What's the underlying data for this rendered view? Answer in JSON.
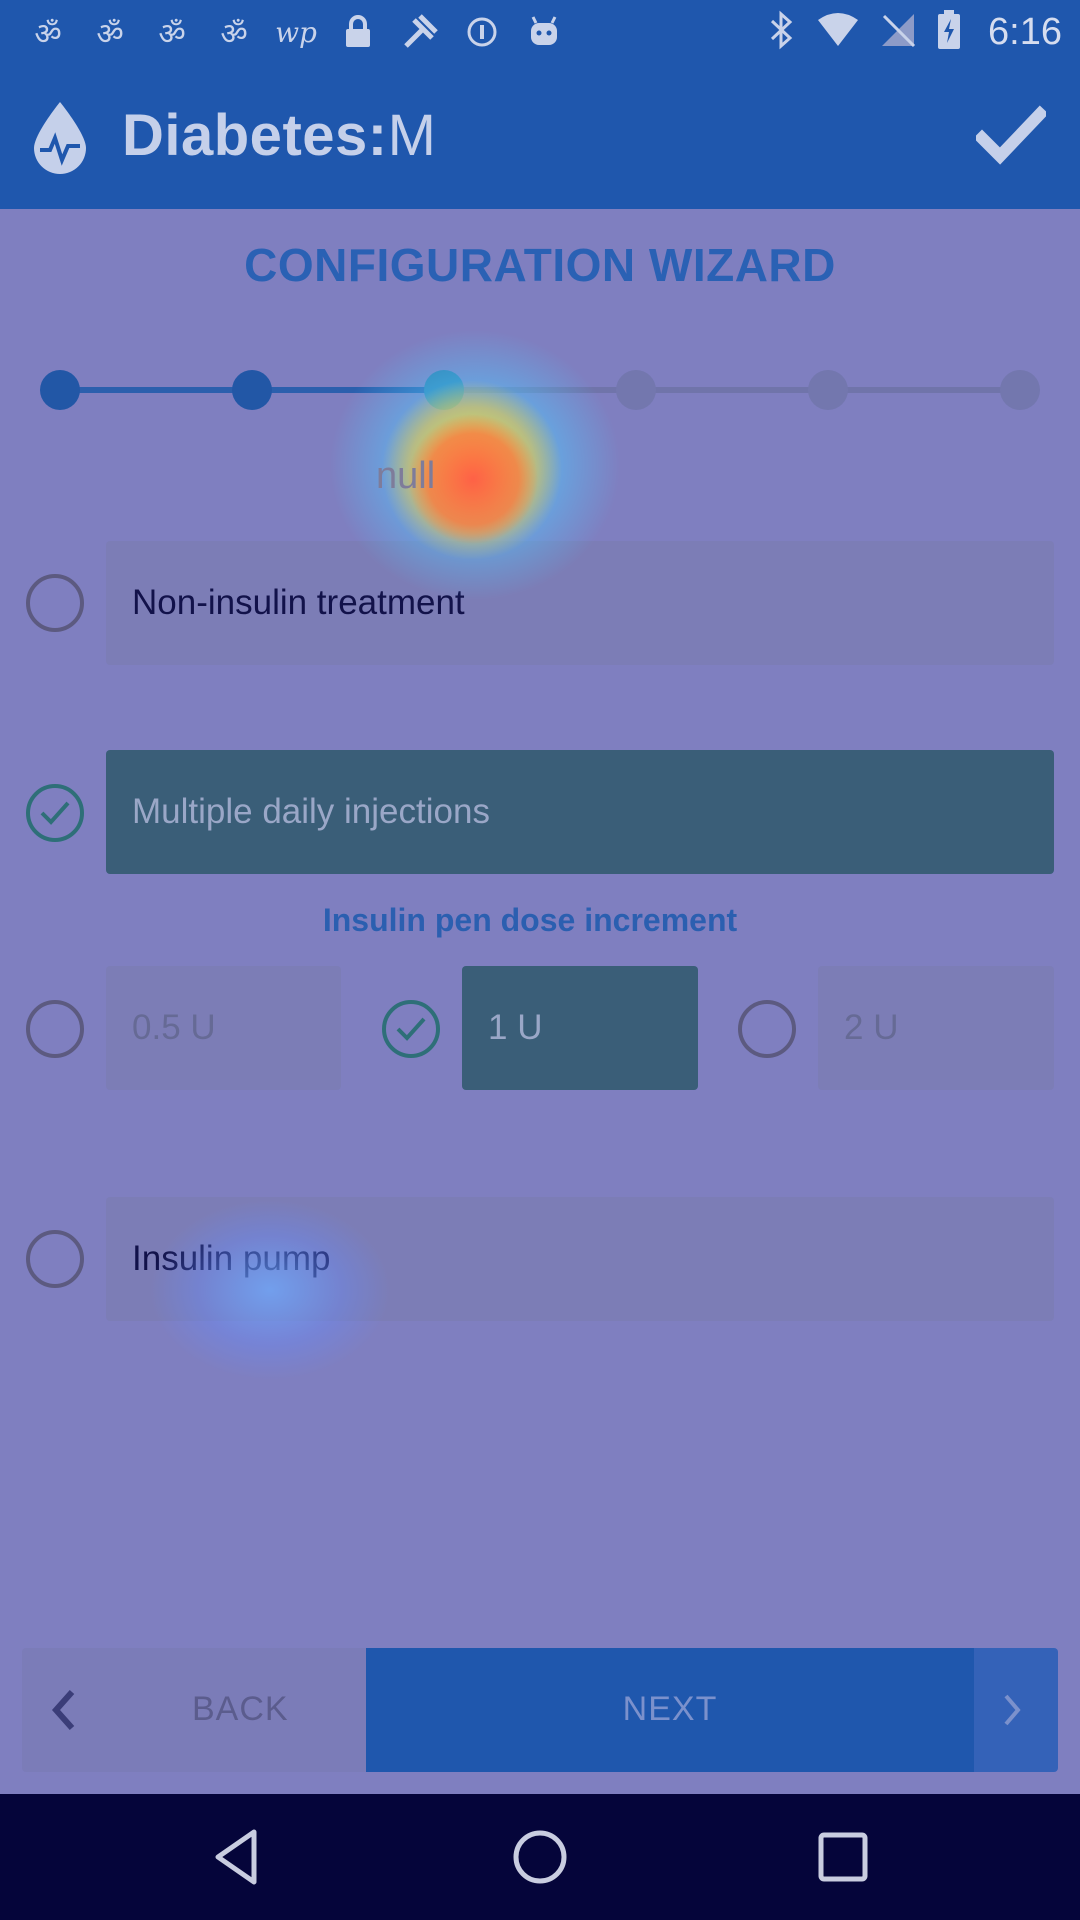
{
  "status_bar": {
    "time": "6:16",
    "left_icons": [
      "notification-icon",
      "notification-icon",
      "notification-icon",
      "notification-icon",
      "wp-icon",
      "lock-icon",
      "satellite-icon",
      "info-icon",
      "android-icon"
    ],
    "right_icons": [
      "bluetooth-icon",
      "wifi-icon",
      "no-sim-icon",
      "battery-charging-icon"
    ]
  },
  "app_bar": {
    "title_bold": "Diabetes:",
    "title_light": "M"
  },
  "wizard": {
    "title": "CONFIGURATION WIZARD",
    "step_label": "null",
    "current_step": 3,
    "total_steps": 6
  },
  "options": {
    "non_insulin": {
      "label": "Non-insulin treatment",
      "selected": false
    },
    "mdi": {
      "label": "Multiple daily injections",
      "selected": true
    },
    "pen_increment": {
      "heading": "Insulin pen dose increment",
      "choices": [
        {
          "label": "0.5 U",
          "selected": false
        },
        {
          "label": "1 U",
          "selected": true
        },
        {
          "label": "2 U",
          "selected": false
        }
      ]
    },
    "pump": {
      "label": "Insulin pump",
      "selected": false
    }
  },
  "bottom_nav": {
    "back_label": "BACK",
    "next_label": "NEXT"
  },
  "colors": {
    "app_blue": "#1f57ad",
    "selected_teal": "#3a5e78",
    "card_bg": "#7c7db6",
    "overlay_bg": "#7f7fc0"
  }
}
